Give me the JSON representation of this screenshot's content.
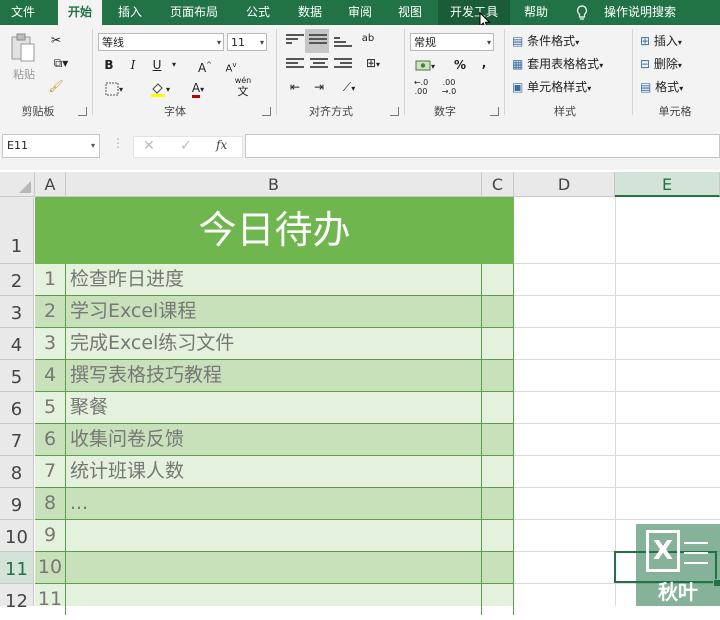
{
  "menu": {
    "file": "文件",
    "home": "开始",
    "insert": "插入",
    "page_layout": "页面布局",
    "formulas": "公式",
    "data": "数据",
    "review": "审阅",
    "view": "视图",
    "developer": "开发工具",
    "help": "帮助",
    "tell_me": "操作说明搜索"
  },
  "ribbon": {
    "clipboard": {
      "paste": "粘贴",
      "label": "剪贴板"
    },
    "font": {
      "name": "等线",
      "size": "11",
      "bold": "B",
      "italic": "I",
      "underline": "U",
      "grow": "A",
      "shrink": "A",
      "color_a": "A",
      "wen": "wén",
      "wen_char": "文",
      "label": "字体"
    },
    "alignment": {
      "label": "对齐方式",
      "wrap": "ab"
    },
    "number": {
      "format": "常规",
      "percent": "%",
      "comma": ",",
      "label": "数字"
    },
    "styles": {
      "conditional": "条件格式",
      "table_format": "套用表格格式",
      "cell_styles": "单元格样式",
      "label": "样式"
    },
    "cells": {
      "insert": "插入",
      "delete": "删除",
      "format": "格式",
      "label": "单元格"
    }
  },
  "formula_bar": {
    "name_box": "E11",
    "cancel": "✕",
    "confirm": "✓",
    "fx": "fx",
    "content": ""
  },
  "columns": [
    "A",
    "B",
    "C",
    "D",
    "E"
  ],
  "rows": [
    "1",
    "2",
    "3",
    "4",
    "5",
    "6",
    "7",
    "8",
    "9",
    "10",
    "11",
    "12"
  ],
  "sheet": {
    "title": "今日待办",
    "items": [
      {
        "num": "1",
        "text": "检查昨日进度"
      },
      {
        "num": "2",
        "text": "学习Excel课程"
      },
      {
        "num": "3",
        "text": "完成Excel练习文件"
      },
      {
        "num": "4",
        "text": "撰写表格技巧教程"
      },
      {
        "num": "5",
        "text": "聚餐"
      },
      {
        "num": "6",
        "text": "收集问卷反馈"
      },
      {
        "num": "7",
        "text": "统计班课人数"
      },
      {
        "num": "8",
        "text": "..."
      },
      {
        "num": "9",
        "text": ""
      },
      {
        "num": "10",
        "text": ""
      },
      {
        "num": "11",
        "text": ""
      }
    ]
  },
  "watermark": {
    "letter": "X",
    "brand": "秋叶"
  },
  "colors": {
    "excel_green": "#217346",
    "title_green": "#70b64f",
    "row_light": "#e4f1dc",
    "row_dark": "#c8e1bb"
  }
}
